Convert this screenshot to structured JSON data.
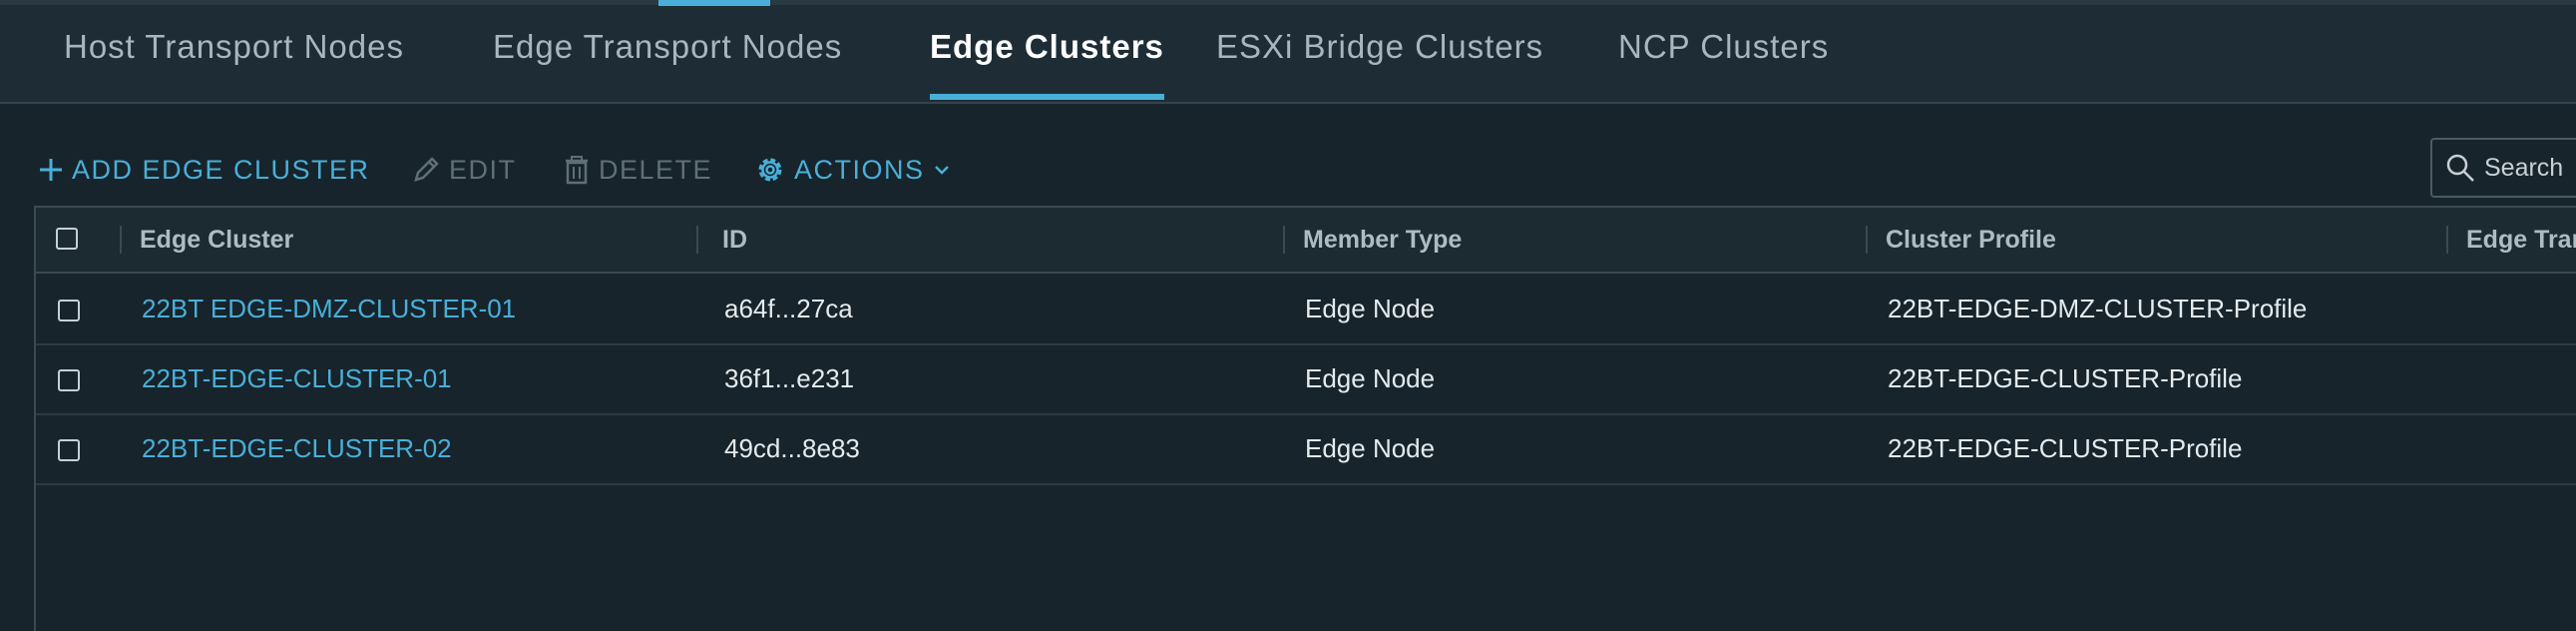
{
  "tabs": [
    {
      "label": "Host Transport Nodes",
      "active": false
    },
    {
      "label": "Edge Transport Nodes",
      "active": false
    },
    {
      "label": "Edge Clusters",
      "active": true
    },
    {
      "label": "ESXi Bridge Clusters",
      "active": false
    },
    {
      "label": "NCP Clusters",
      "active": false
    }
  ],
  "toolbar": {
    "add_label": "ADD EDGE CLUSTER",
    "edit_label": "EDIT",
    "delete_label": "DELETE",
    "actions_label": "ACTIONS",
    "search_label": "Search"
  },
  "grid": {
    "columns": [
      "Edge Cluster",
      "ID",
      "Member Type",
      "Cluster Profile",
      "Edge Trar"
    ],
    "rows": [
      {
        "name": "22BT EDGE-DMZ-CLUSTER-01",
        "id": "a64f...27ca",
        "member_type": "Edge Node",
        "profile": "22BT-EDGE-DMZ-CLUSTER-Profile"
      },
      {
        "name": "22BT-EDGE-CLUSTER-01",
        "id": "36f1...e231",
        "member_type": "Edge Node",
        "profile": "22BT-EDGE-CLUSTER-Profile"
      },
      {
        "name": "22BT-EDGE-CLUSTER-02",
        "id": "49cd...8e83",
        "member_type": "Edge Node",
        "profile": "22BT-EDGE-CLUSTER-Profile"
      }
    ]
  },
  "colors": {
    "accent": "#49afd9",
    "background": "#17242b",
    "disabled": "#5f6f78"
  }
}
